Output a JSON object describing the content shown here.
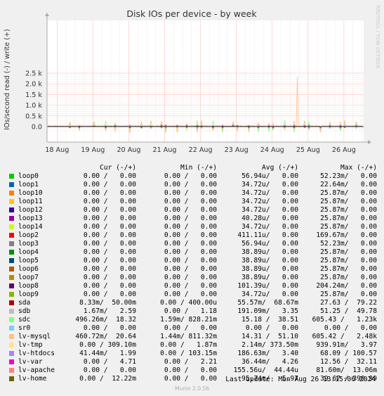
{
  "chart_data": {
    "type": "line",
    "title": "Disk IOs per device - by week",
    "ylabel": "IOs/second read (-) / write (+)",
    "watermark": "RRDTOOL / TOBI OETIKER",
    "ylim": [
      -0.25,
      2.5
    ],
    "y_ticks": [
      "0.0",
      "0.5 k",
      "1.0 k",
      "1.5 k",
      "2.0 k",
      "2.5 k"
    ],
    "y_tick_values": [
      0,
      500,
      1000,
      1500,
      2000,
      2500
    ],
    "x_ticks": [
      "18 Aug",
      "19 Aug",
      "20 Aug",
      "21 Aug",
      "22 Aug",
      "23 Aug",
      "24 Aug",
      "25 Aug",
      "26 Aug"
    ],
    "grid": true,
    "spike": {
      "series": "lv-mysql",
      "day": 24.7,
      "value": 2330
    },
    "columns": [
      "Cur (-/+)",
      "Min (-/+)",
      "Avg (-/+)",
      "Max (-/+)"
    ],
    "series": [
      {
        "name": "loop0",
        "color": "#00cc00",
        "cur": "0.00 /   0.00",
        "min": "0.00 /   0.00",
        "avg": "56.94u/   0.00",
        "max": "52.23m/   0.00"
      },
      {
        "name": "loop1",
        "color": "#0066b3",
        "cur": "0.00 /   0.00",
        "min": "0.00 /   0.00",
        "avg": "34.72u/   0.00",
        "max": "22.64m/   0.00"
      },
      {
        "name": "loop10",
        "color": "#ff8000",
        "cur": "0.00 /   0.00",
        "min": "0.00 /   0.00",
        "avg": "34.72u/   0.00",
        "max": "25.87m/   0.00"
      },
      {
        "name": "loop11",
        "color": "#ffcc00",
        "cur": "0.00 /   0.00",
        "min": "0.00 /   0.00",
        "avg": "34.72u/   0.00",
        "max": "25.87m/   0.00"
      },
      {
        "name": "loop12",
        "color": "#330099",
        "cur": "0.00 /   0.00",
        "min": "0.00 /   0.00",
        "avg": "34.72u/   0.00",
        "max": "25.87m/   0.00"
      },
      {
        "name": "loop13",
        "color": "#990099",
        "cur": "0.00 /   0.00",
        "min": "0.00 /   0.00",
        "avg": "40.28u/   0.00",
        "max": "25.87m/   0.00"
      },
      {
        "name": "loop14",
        "color": "#ccff00",
        "cur": "0.00 /   0.00",
        "min": "0.00 /   0.00",
        "avg": "34.72u/   0.00",
        "max": "25.87m/   0.00"
      },
      {
        "name": "loop2",
        "color": "#ff0000",
        "cur": "0.00 /   0.00",
        "min": "0.00 /   0.00",
        "avg": "411.11u/   0.00",
        "max": "169.67m/   0.00"
      },
      {
        "name": "loop3",
        "color": "#808080",
        "cur": "0.00 /   0.00",
        "min": "0.00 /   0.00",
        "avg": "56.94u/   0.00",
        "max": "52.23m/   0.00"
      },
      {
        "name": "loop4",
        "color": "#008f00",
        "cur": "0.00 /   0.00",
        "min": "0.00 /   0.00",
        "avg": "38.89u/   0.00",
        "max": "25.87m/   0.00"
      },
      {
        "name": "loop5",
        "color": "#00487d",
        "cur": "0.00 /   0.00",
        "min": "0.00 /   0.00",
        "avg": "38.89u/   0.00",
        "max": "25.87m/   0.00"
      },
      {
        "name": "loop6",
        "color": "#b35a00",
        "cur": "0.00 /   0.00",
        "min": "0.00 /   0.00",
        "avg": "38.89u/   0.00",
        "max": "25.87m/   0.00"
      },
      {
        "name": "loop7",
        "color": "#b38f00",
        "cur": "0.00 /   0.00",
        "min": "0.00 /   0.00",
        "avg": "38.89u/   0.00",
        "max": "25.87m/   0.00"
      },
      {
        "name": "loop8",
        "color": "#6b006b",
        "cur": "0.00 /   0.00",
        "min": "0.00 /   0.00",
        "avg": "101.39u/   0.00",
        "max": "204.24m/   0.00"
      },
      {
        "name": "loop9",
        "color": "#8fb300",
        "cur": "0.00 /   0.00",
        "min": "0.00 /   0.00",
        "avg": "34.72u/   0.00",
        "max": "25.87m/   0.00"
      },
      {
        "name": "sda",
        "color": "#b30000",
        "cur": "8.33m/  50.00m",
        "min": "0.00 / 400.00u",
        "avg": "55.57m/  68.67m",
        "max": "27.63 /  79.22"
      },
      {
        "name": "sdb",
        "color": "#bebebe",
        "cur": "1.67m/   2.59",
        "min": "0.00 /   1.18",
        "avg": "191.09m/   3.35",
        "max": "51.25 /  49.78"
      },
      {
        "name": "sdc",
        "color": "#80ff80",
        "cur": "496.26m/  18.32",
        "min": "1.59m/ 828.21m",
        "avg": "15.18 /  38.51",
        "max": "605.43 /   1.23k"
      },
      {
        "name": "sr0",
        "color": "#80c9ff",
        "cur": "0.00 /   0.00",
        "min": "0.00 /   0.00",
        "avg": "0.00 /   0.00",
        "max": "0.00 /   0.00"
      },
      {
        "name": "lv-mysql",
        "color": "#ffc080",
        "cur": "460.72m/  20.64",
        "min": "1.44m/ 811.32m",
        "avg": "14.31 /  51.10",
        "max": "605.42 /   2.48k"
      },
      {
        "name": "lv-tmp",
        "color": "#ffe680",
        "cur": "0.00 / 309.10m",
        "min": "0.00 /   1.87m",
        "avg": "2.14m/ 373.50m",
        "max": "939.91m/   3.97"
      },
      {
        "name": "lv-htdocs",
        "color": "#aa80ff",
        "cur": "41.44m/   1.99",
        "min": "0.00 / 103.15m",
        "avg": "186.63m/   3.40",
        "max": "68.09 / 100.57"
      },
      {
        "name": "lv-var",
        "color": "#ee00cc",
        "cur": "0.00 /   4.71",
        "min": "0.00 /   2.21",
        "avg": "36.44m/   4.26",
        "max": "12.56 /  32.11"
      },
      {
        "name": "lv-apache",
        "color": "#ff8080",
        "cur": "0.00 /   0.00",
        "min": "0.00 /   0.00",
        "avg": "155.56u/  44.44u",
        "max": "81.60m/  13.06m"
      },
      {
        "name": "lv-home",
        "color": "#666600",
        "cur": "0.00 /  12.22m",
        "min": "0.00 /   0.00",
        "avg": "95.74m/   5.97",
        "max": "39.67 / 390.99"
      }
    ]
  },
  "footer": {
    "last_update": "Last update: Mon Aug 26 13:15:06 2024",
    "munin": "Munin 2.0.56"
  }
}
